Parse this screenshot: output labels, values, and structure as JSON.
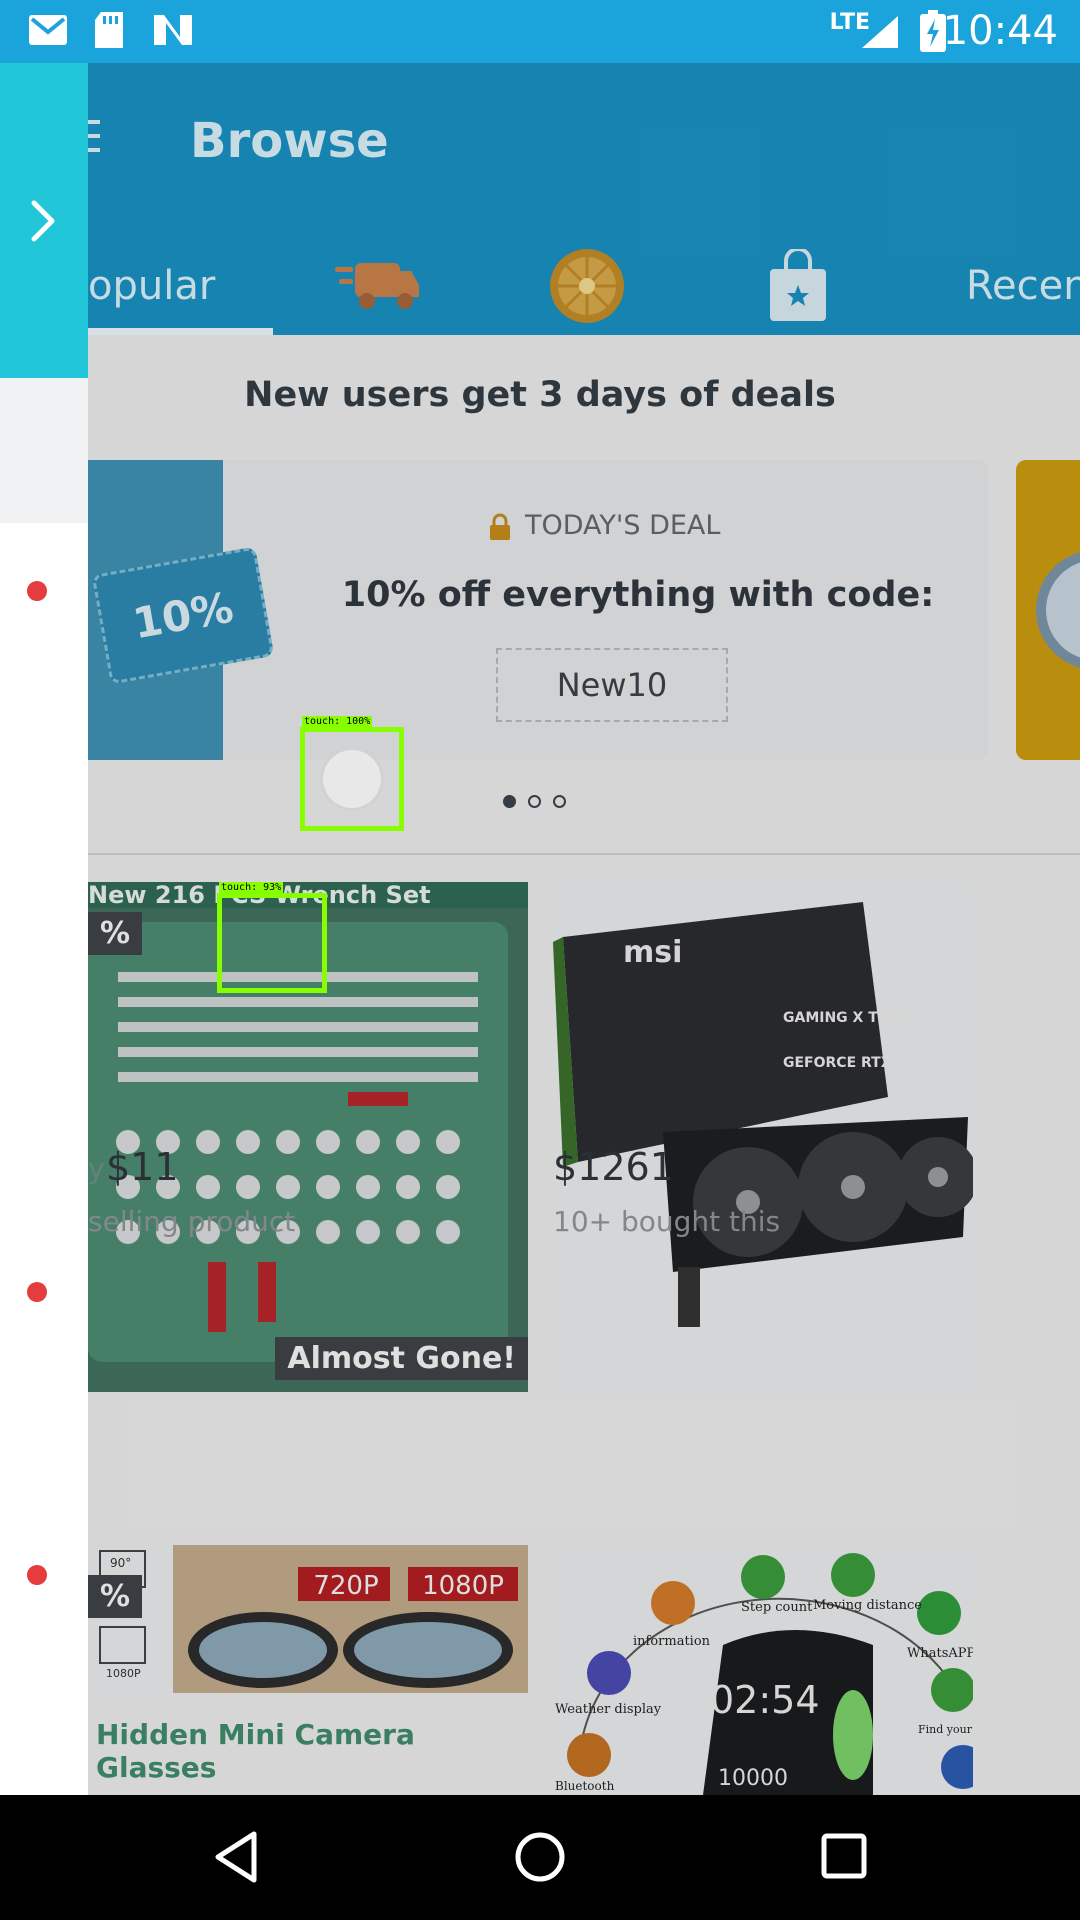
{
  "status_bar": {
    "time": "10:44",
    "network": "LTE"
  },
  "app_bar": {
    "title": "Browse"
  },
  "tabs": [
    {
      "label": "opular"
    },
    {
      "label": "Recen"
    }
  ],
  "promo": {
    "headline": "New users get 3 days of deals",
    "ticket_text": "10%",
    "label": "TODAY'S DEAL",
    "offer": "10% off everything with code:",
    "code": "New10"
  },
  "products": [
    {
      "badge": "%",
      "overlay": "Almost Gone!",
      "price": "$11",
      "subtitle": "selling product",
      "partial_prefix": "y"
    },
    {
      "price": "$1261",
      "subtitle": "10+ bought this"
    },
    {
      "badge": "%",
      "title": "Hidden Mini Camera Glasses",
      "tags": [
        "720P",
        "1080P"
      ],
      "spec_labels": [
        "90°",
        "1080P"
      ]
    },
    {
      "features": [
        "Step count",
        "Moving distance",
        "information",
        "WhatsAPP",
        "Weather display",
        "Find your phone",
        "Bluetooth"
      ],
      "watch_time": "02:54",
      "steps": "10000"
    }
  ],
  "detections": [
    {
      "label": "touch: 100%"
    },
    {
      "label": "touch: 93%"
    }
  ],
  "graphics": {
    "wrench_banner": "New 216 PCS Wrench Set",
    "gpu_brand": "msi",
    "gpu_box_title": "GAMING X TRIO",
    "gpu_box_model": "GEFORCE RTX"
  },
  "colors": {
    "status_bar": "#1ba3db",
    "app_bar": "#1a8fc0",
    "drawer_accent": "#22c6d9",
    "detection": "#88ff00"
  }
}
